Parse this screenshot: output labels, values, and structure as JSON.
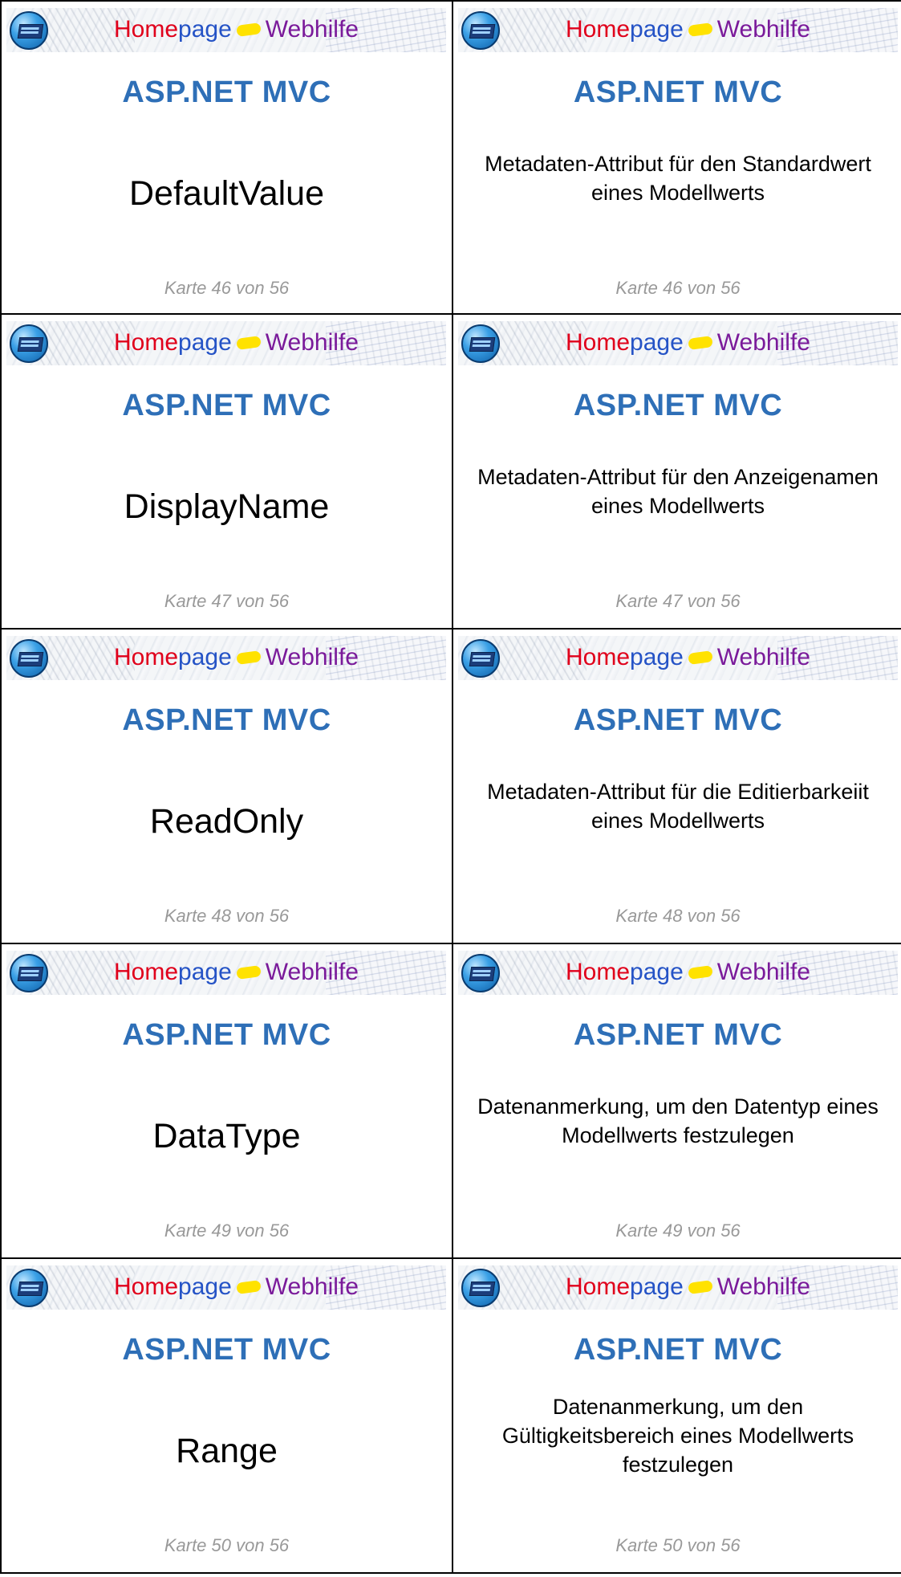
{
  "banner": {
    "brand_part1": "Home",
    "brand_part2": "page",
    "brand_part3": "Webhilfe",
    "logo_icon": "monitor-globe-logo"
  },
  "deck_title": "ASP.NET MVC",
  "colors": {
    "title_blue": "#2e6fb7",
    "counter_gray": "#999999",
    "brand_red": "#e0001b",
    "brand_blue": "#2553c6",
    "brand_purple": "#7a1a9a",
    "arrow_yellow": "#ffe200"
  },
  "cards": [
    {
      "term": "DefaultValue",
      "definition": "Metadaten-Attribut für den Standardwert eines Modellwerts",
      "counter": "Karte 46 von 56"
    },
    {
      "term": "DisplayName",
      "definition": "Metadaten-Attribut für den Anzeigenamen eines Modellwerts",
      "counter": "Karte 47 von 56"
    },
    {
      "term": "ReadOnly",
      "definition": "Metadaten-Attribut für die Editierbarkeiit eines Modellwerts",
      "counter": "Karte 48 von 56"
    },
    {
      "term": "DataType",
      "definition": "Datenanmerkung, um den Datentyp eines Modellwerts festzulegen",
      "counter": "Karte 49 von 56"
    },
    {
      "term": "Range",
      "definition": "Datenanmerkung, um den Gültigkeitsbereich eines Modellwerts festzulegen",
      "counter": "Karte 50 von 56"
    }
  ]
}
